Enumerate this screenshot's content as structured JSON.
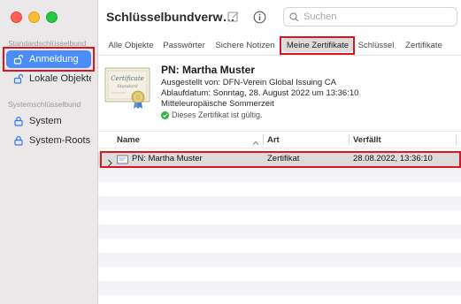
{
  "sidebar": {
    "section1_title": "Standardschlüsselbund",
    "item_anmeldung": "Anmeldung",
    "item_lokale": "Lokale Objekte",
    "section2_title": "Systemschlüsselbund",
    "item_system": "System",
    "item_system_roots": "System-Roots"
  },
  "toolbar": {
    "title": "Schlüsselbundverw…",
    "search_placeholder": "Suchen",
    "icons": [
      "window-close-red",
      "window-minimize-yellow",
      "window-maximize-green",
      "edit-icon",
      "info-icon",
      "search-icon"
    ]
  },
  "tabs": {
    "alle_objekte": "Alle Objekte",
    "passwoerter": "Passwörter",
    "sichere_notizen": "Sichere Notizen",
    "meine_zertifikate": "Meine Zertifikate",
    "schluessel": "Schlüssel",
    "zertifikate": "Zertifikate",
    "active": "Meine Zertifikate"
  },
  "certificate": {
    "image_caption": "Certificate",
    "image_subcaption": "Standard",
    "name": "PN: Martha Muster",
    "issued_by": "Ausgestellt von: DFN-Verein Global Issuing CA",
    "expires": "Ablaufdatum: Sonntag, 28. August 2022 um 13:36:10",
    "timezone": "Mitteleuropäische Sommerzeit",
    "status": "Dieses Zertifikat ist gültig."
  },
  "table": {
    "col_name": "Name",
    "col_art": "Art",
    "col_verfaellt": "Verfällt",
    "rows": [
      {
        "name": "PN: Martha Muster",
        "art": "Zertifikat",
        "verfaellt": "28.08.2022, 13:36:10"
      }
    ]
  },
  "colors": {
    "highlight": "#e0141e",
    "sidebar_selected": "#4a8df6",
    "valid_green": "#2fb344"
  }
}
